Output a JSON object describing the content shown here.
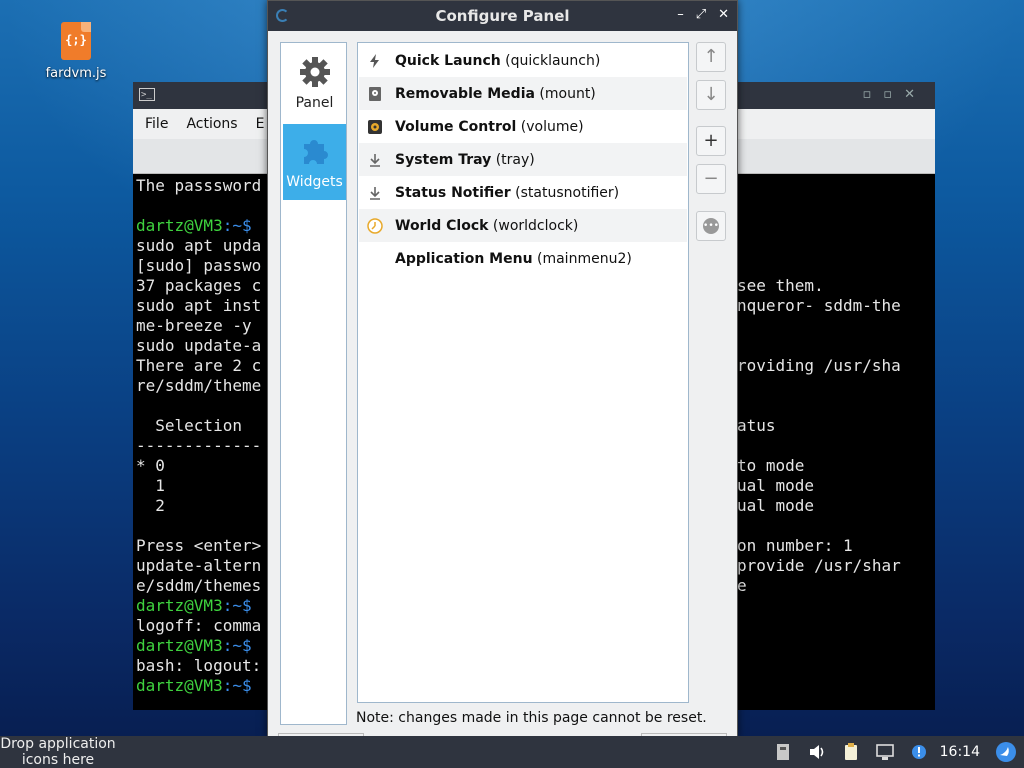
{
  "desktop": {
    "icon_label": "fardvm.js",
    "icon_glyph": "{;}"
  },
  "terminal": {
    "menu": [
      "File",
      "Actions",
      "E"
    ],
    "lines": [
      {
        "t": "The passsword"
      },
      {
        "t": ""
      },
      {
        "prompt": "dartz@VM3",
        "path": ":~$"
      },
      {
        "t": "sudo apt upda"
      },
      {
        "t": "[sudo] passwo"
      },
      {
        "t": "37 packages c"
      },
      {
        "t": "sudo apt inst"
      },
      {
        "t": "me-breeze -y"
      },
      {
        "t": "sudo update-a"
      },
      {
        "t": "There are 2 c"
      },
      {
        "t": "re/sddm/theme"
      },
      {
        "t": ""
      },
      {
        "t": "  Selection"
      },
      {
        "t": "-------------"
      },
      {
        "t": "* 0"
      },
      {
        "t": "  1"
      },
      {
        "t": "  2"
      },
      {
        "t": ""
      },
      {
        "t": "Press <enter>"
      },
      {
        "t": "update-altern"
      },
      {
        "t": "e/sddm/themes"
      },
      {
        "prompt": "dartz@VM3",
        "path": ":~$"
      },
      {
        "t": "logoff: comma"
      },
      {
        "prompt": "dartz@VM3",
        "path": ":~$"
      },
      {
        "t": "bash: logout:"
      },
      {
        "prompt": "dartz@VM3",
        "path": ":~$"
      }
    ],
    "right_lines": [
      "",
      "",
      "",
      "",
      "",
      "see them.",
      "nqueror- sddm-the",
      "",
      "",
      "roviding /usr/sha",
      "",
      "",
      "atus",
      "",
      "to mode",
      "ual mode",
      "ual mode",
      "",
      "on number: 1",
      "provide /usr/shar",
      "e"
    ]
  },
  "dialog": {
    "title": "Configure Panel",
    "sidebar": [
      {
        "label": "Panel",
        "icon": "gear-icon"
      },
      {
        "label": "Widgets",
        "icon": "puzzle-icon",
        "selected": true
      }
    ],
    "widgets": [
      {
        "name": "Quick Launch",
        "id": "(quicklaunch)",
        "icon": "lightning-icon"
      },
      {
        "name": "Removable Media",
        "id": "(mount)",
        "icon": "drive-icon"
      },
      {
        "name": "Volume Control",
        "id": "(volume)",
        "icon": "speaker-icon"
      },
      {
        "name": "System Tray",
        "id": "(tray)",
        "icon": "tray-arrow-icon"
      },
      {
        "name": "Status Notifier",
        "id": "(statusnotifier)",
        "icon": "tray-arrow-icon"
      },
      {
        "name": "World Clock",
        "id": "(worldclock)",
        "icon": "clock-icon"
      },
      {
        "name": "Application Menu",
        "id": "(mainmenu2)",
        "icon": ""
      }
    ],
    "buttons": {
      "up": "↑",
      "down": "↓",
      "add": "+",
      "remove": "−",
      "settings": "•••"
    },
    "note": "Note: changes made in this page cannot be reset."
  },
  "taskbar": {
    "drop_text": "Drop application icons here",
    "clock": "16:14"
  }
}
